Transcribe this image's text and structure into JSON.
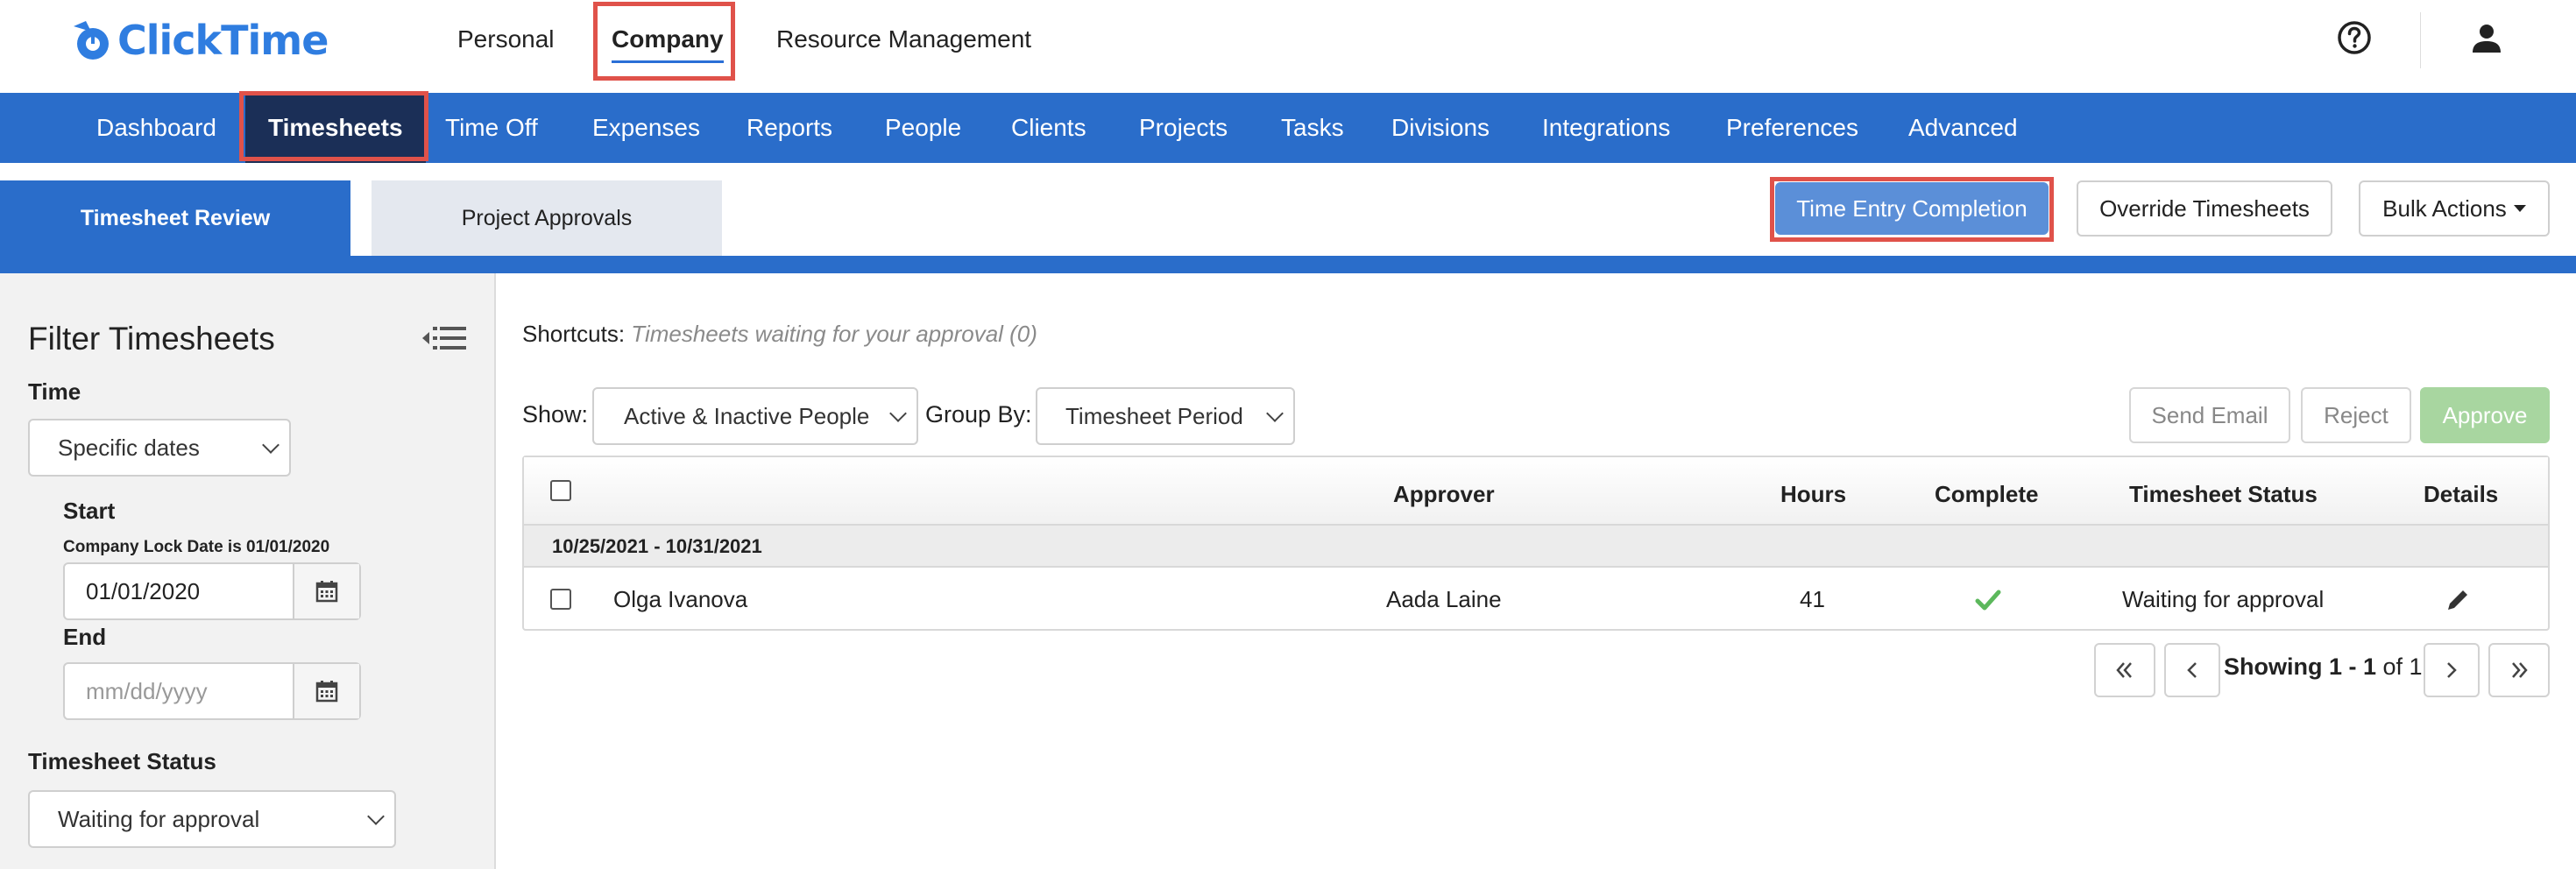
{
  "brand": {
    "name": "ClickTime",
    "color": "#2f7de0"
  },
  "top_nav": {
    "personal": "Personal",
    "company": "Company",
    "resource": "Resource Management"
  },
  "main_nav": [
    {
      "label": "Dashboard"
    },
    {
      "label": "Timesheets",
      "active": true
    },
    {
      "label": "Time Off"
    },
    {
      "label": "Expenses"
    },
    {
      "label": "Reports"
    },
    {
      "label": "People"
    },
    {
      "label": "Clients"
    },
    {
      "label": "Projects"
    },
    {
      "label": "Tasks"
    },
    {
      "label": "Divisions"
    },
    {
      "label": "Integrations"
    },
    {
      "label": "Preferences"
    },
    {
      "label": "Advanced"
    }
  ],
  "sub_tabs": {
    "review": "Timesheet Review",
    "approvals": "Project Approvals"
  },
  "actions": {
    "time_entry_completion": "Time Entry Completion",
    "override_timesheets": "Override Timesheets",
    "bulk_actions": "Bulk Actions"
  },
  "filter": {
    "title": "Filter Timesheets",
    "time_label": "Time",
    "time_value": "Specific dates",
    "start_label": "Start",
    "lock_note": "Company Lock Date is 01/01/2020",
    "start_value": "01/01/2020",
    "end_label": "End",
    "end_placeholder": "mm/dd/yyyy",
    "status_label": "Timesheet Status",
    "status_value": "Waiting for approval"
  },
  "shortcuts": {
    "label": "Shortcuts:",
    "link": "Timesheets waiting for your approval (0)"
  },
  "controls": {
    "show_label": "Show:",
    "show_value": "Active & Inactive People",
    "group_label": "Group By:",
    "group_value": "Timesheet Period",
    "send_email": "Send Email",
    "reject": "Reject",
    "approve": "Approve"
  },
  "table": {
    "headers": {
      "approver": "Approver",
      "hours": "Hours",
      "complete": "Complete",
      "status": "Timesheet Status",
      "details": "Details"
    },
    "group": "10/25/2021 - 10/31/2021",
    "rows": [
      {
        "name": "Olga Ivanova",
        "approver": "Aada Laine",
        "hours": "41",
        "complete": true,
        "status": "Waiting for approval"
      }
    ]
  },
  "pager": {
    "showing": "Showing 1 - 1",
    "of": "of 1"
  },
  "colors": {
    "primary_blue": "#2a6dca",
    "active_nav": "#1b2f57",
    "highlight_red": "#e0524a",
    "approve_green": "#a8d6a0",
    "check_green": "#5cb85c"
  },
  "icons": [
    "help-icon",
    "user-icon",
    "collapse-filter-icon",
    "calendar-icon",
    "pencil-icon",
    "checkmark-icon",
    "first-page-icon",
    "prev-page-icon",
    "next-page-icon",
    "last-page-icon"
  ]
}
